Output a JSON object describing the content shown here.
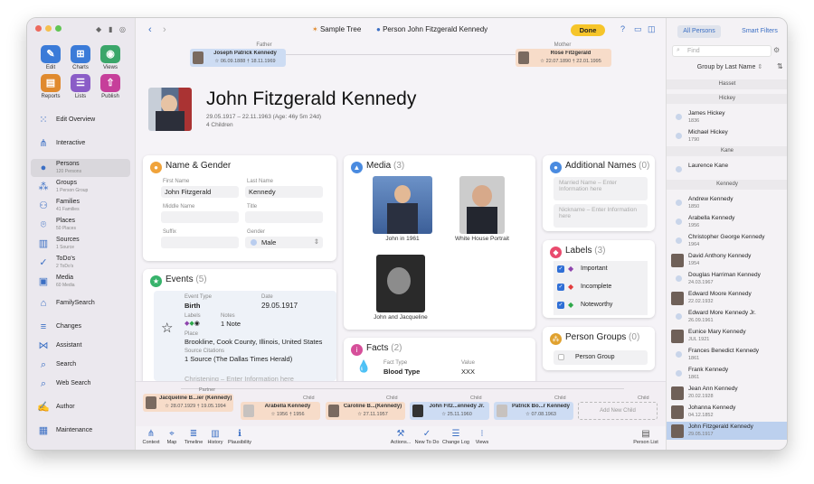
{
  "toolbar": {
    "edit": "Edit",
    "charts": "Charts",
    "views": "Views",
    "reports": "Reports",
    "lists": "Lists",
    "publish": "Publish"
  },
  "nav": [
    {
      "label": "Edit Overview",
      "sub": ""
    },
    {
      "label": "Interactive",
      "sub": ""
    },
    {
      "label": "Persons",
      "sub": "120 Persons"
    },
    {
      "label": "Groups",
      "sub": "1 Person Group"
    },
    {
      "label": "Families",
      "sub": "41 Families"
    },
    {
      "label": "Places",
      "sub": "50 Places"
    },
    {
      "label": "Sources",
      "sub": "1 Source"
    },
    {
      "label": "ToDo's",
      "sub": "2 ToDo's"
    },
    {
      "label": "Media",
      "sub": "60 Media"
    },
    {
      "label": "FamilySearch",
      "sub": ""
    },
    {
      "label": "Changes",
      "sub": ""
    },
    {
      "label": "Assistant",
      "sub": ""
    },
    {
      "label": "Search",
      "sub": ""
    },
    {
      "label": "Web Search",
      "sub": ""
    },
    {
      "label": "Author",
      "sub": ""
    },
    {
      "label": "Maintenance",
      "sub": ""
    }
  ],
  "header": {
    "tree": "Sample Tree",
    "person": "Person John Fitzgerald Kennedy",
    "done": "Done"
  },
  "parents": {
    "father_label": "Father",
    "father_name": "Joseph Patrick Kennedy",
    "father_dates": "☆ 06.09.1888  † 18.11.1969",
    "mother_label": "Mother",
    "mother_name": "Rose Fitzgerald",
    "mother_dates": "☆ 22.07.1890  † 22.01.1995"
  },
  "person": {
    "name": "John Fitzgerald Kennedy",
    "dates": "29.05.1917 – 22.11.1963 (Age: 46y 5m 24d)",
    "children": "4 Children"
  },
  "name_gender": {
    "title": "Name & Gender",
    "first_label": "First Name",
    "first": "John Fitzgerald",
    "last_label": "Last Name",
    "last": "Kennedy",
    "middle_label": "Middle Name",
    "title_label": "Title",
    "suffix_label": "Suffix",
    "gender_label": "Gender",
    "gender": "Male"
  },
  "media": {
    "title": "Media",
    "count": "(3)",
    "items": [
      "John in 1961",
      "White House Portrait",
      "John and Jacqueline"
    ]
  },
  "additional_names": {
    "title": "Additional Names",
    "count": "(0)",
    "married": "Married Name – Enter Information here",
    "nickname": "Nickname – Enter Information here"
  },
  "labels": {
    "title": "Labels",
    "count": "(3)",
    "items": [
      "Important",
      "Incomplete",
      "Noteworthy"
    ],
    "colors": [
      "#8e44ad",
      "#e23b3b",
      "#2ea84a"
    ]
  },
  "person_groups": {
    "title": "Person Groups",
    "count": "(0)",
    "item": "Person Group"
  },
  "events": {
    "title": "Events",
    "count": "(5)",
    "type_label": "Event Type",
    "type": "Birth",
    "date_label": "Date",
    "date": "29.05.1917",
    "labels_label": "Labels",
    "notes_label": "Notes",
    "notes": "1 Note",
    "place_label": "Place",
    "place": "Brookline, Cook County, Illinois, United States",
    "src_label": "Source Citations",
    "src": "1 Source (The Dallas Times Herald)",
    "next": "Christening – Enter Information here"
  },
  "facts": {
    "title": "Facts",
    "count": "(2)",
    "type_label": "Fact Type",
    "type": "Blood Type",
    "value_label": "Value",
    "value": "XXX"
  },
  "family": {
    "partner_label": "Partner",
    "child_label": "Child",
    "partner_name": "Jacqueline B...ier (Kennedy)",
    "partner_dates": "☆ 28.07.1929  † 19.05.1994",
    "children": [
      {
        "name": "Arabella Kennedy",
        "dates": "☆ 1956  † 1956"
      },
      {
        "name": "Caroline B...(Kennedy)",
        "dates": "☆ 27.11.1957"
      },
      {
        "name": "John Fitz...ennedy Jr.",
        "dates": "☆ 25.11.1960"
      },
      {
        "name": "Patrick Bo...r Kennedy",
        "dates": "☆ 07.08.1963"
      }
    ],
    "add": "Add New Child"
  },
  "bottom": [
    "Context",
    "Map",
    "Timeline",
    "History",
    "Plausibility",
    "Actions...",
    "New To Do",
    "Change Log",
    "Views",
    "Person List"
  ],
  "right": {
    "tab1": "All Persons",
    "tab2": "Smart Filters",
    "find": "Find",
    "group": "Group by Last Name",
    "list": [
      {
        "h": "Hasset"
      },
      {
        "h": "Hickey"
      },
      {
        "n": "James Hickey",
        "d": "1836"
      },
      {
        "n": "Michael Hickey",
        "d": "1790"
      },
      {
        "h": "Kane"
      },
      {
        "n": "Laurence Kane",
        "d": ""
      },
      {
        "h": "Kennedy"
      },
      {
        "n": "Andrew Kennedy",
        "d": "1850"
      },
      {
        "n": "Arabella Kennedy",
        "d": "1956"
      },
      {
        "n": "Christopher George Kennedy",
        "d": "1964"
      },
      {
        "n": "David Anthony Kennedy",
        "d": "1954"
      },
      {
        "n": "Douglas Harriman Kennedy",
        "d": "24.03.1967"
      },
      {
        "n": "Edward Moore Kennedy",
        "d": "22.02.1932"
      },
      {
        "n": "Edward More Kennedy Jr.",
        "d": "26.09.1961"
      },
      {
        "n": "Eunice Mary Kennedy",
        "d": "JUL 1921"
      },
      {
        "n": "Frances Benedict Kennedy",
        "d": "1861"
      },
      {
        "n": "Frank Kennedy",
        "d": "1861"
      },
      {
        "n": "Jean Ann Kennedy",
        "d": "20.02.1928"
      },
      {
        "n": "Johanna Kennedy",
        "d": "04.12.1852"
      },
      {
        "n": "John Fitzgerald Kennedy",
        "d": "29.05.1917"
      }
    ]
  }
}
